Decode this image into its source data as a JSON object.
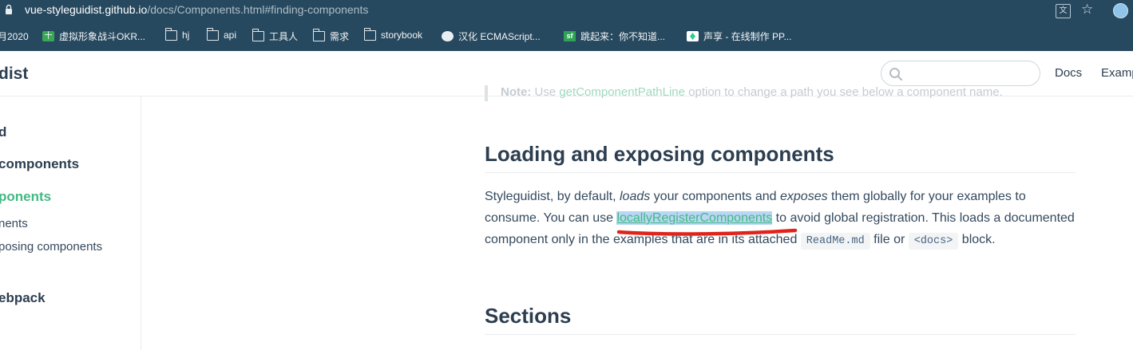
{
  "browser": {
    "url_host": "vue-styleguidist.github.io",
    "url_path": "/docs/Components.html#finding-components",
    "translate_icon": "translate-icon",
    "star_icon": "star-icon"
  },
  "bookmarks": [
    {
      "label": "月2020",
      "icon": ""
    },
    {
      "label": "虚拟形象战斗OKR...",
      "icon": "green-cross-icon"
    },
    {
      "label": "hj",
      "icon": "folder-icon"
    },
    {
      "label": "api",
      "icon": "folder-icon"
    },
    {
      "label": "工具人",
      "icon": "folder-icon"
    },
    {
      "label": "需求",
      "icon": "folder-icon"
    },
    {
      "label": "storybook",
      "icon": "folder-icon"
    },
    {
      "label": "汉化 ECMAScript...",
      "icon": "github-icon"
    },
    {
      "label": "跳起来：你不知道...",
      "icon": "sf-icon"
    },
    {
      "label": "声享 - 在线制作 PP...",
      "icon": "shengxiang-icon"
    }
  ],
  "header": {
    "title": "dist",
    "search_placeholder": "",
    "nav": [
      "Docs",
      "Examp"
    ]
  },
  "sidebar": {
    "items": [
      {
        "label": "d"
      },
      {
        "label": "components"
      },
      {
        "label": "ponents"
      },
      {
        "label": "nents"
      },
      {
        "label": "posing components"
      },
      {
        "label": "ebpack"
      }
    ]
  },
  "content": {
    "note_prefix": "Note:",
    "note_mid": " Use ",
    "note_code": "getComponentPathLine",
    "note_suffix": " option to change a path you see below a component name.",
    "section1_title": "Loading and exposing components",
    "p1": "Styleguidist, by default, ",
    "p1_em1": "loads",
    "p1b": " your components and ",
    "p1_em2": "exposes",
    "p1c": " them globally for your examples to consume. You can use ",
    "p1_link": "locallyRegisterComponents",
    "p1d": " to avoid global registration. This loads a documented component only in the examples that are in its attached ",
    "p1_code1": "ReadMe.md",
    "p1e": " file or ",
    "p1_code2": "<docs>",
    "p1f": " block.",
    "section2_title": "Sections"
  },
  "colors": {
    "brand_green": "#42b983",
    "browser_chrome": "#27495f",
    "annotation_red": "#e0241b"
  }
}
